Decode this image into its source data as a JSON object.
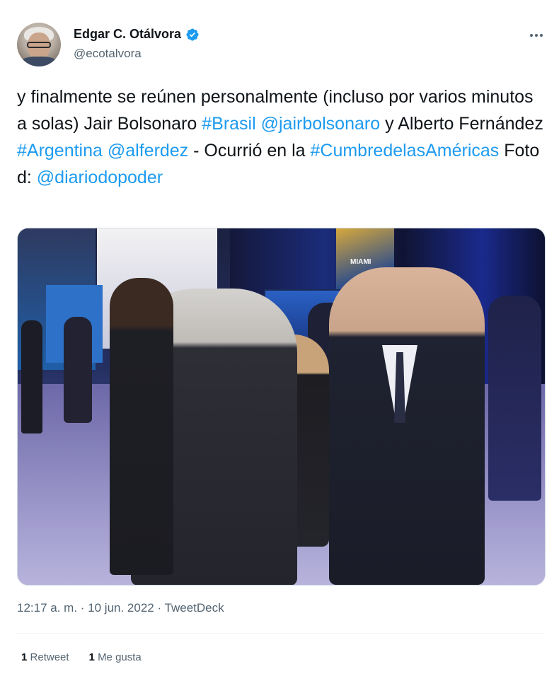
{
  "author": {
    "display_name": "Edgar C. Otálvora",
    "handle": "@ecotalvora",
    "verified": true
  },
  "tweet": {
    "segments": [
      {
        "text": "y finalmente se reúnen personalmente (incluso por varios minutos a solas) Jair Bolsonaro ",
        "link": false
      },
      {
        "text": "#Brasil",
        "link": true
      },
      {
        "text": " ",
        "link": false
      },
      {
        "text": "@jairbolsonaro",
        "link": true
      },
      {
        "text": " y Alberto Fernández ",
        "link": false
      },
      {
        "text": "#Argentina",
        "link": true
      },
      {
        "text": " ",
        "link": false
      },
      {
        "text": "@alferdez",
        "link": true
      },
      {
        "text": " - Ocurrió en la ",
        "link": false
      },
      {
        "text": "#CumbredelasAméricas",
        "link": true
      },
      {
        "text": " Foto d: ",
        "link": false
      },
      {
        "text": "@diariodopoder",
        "link": true
      }
    ],
    "photo_sign_text": "MIAMI"
  },
  "meta": {
    "timestamp": "12:17 a. m. · 10 jun. 2022 · TweetDeck"
  },
  "stats": {
    "retweets_count": "1",
    "retweets_label": "Retweet",
    "likes_count": "1",
    "likes_label": "Me gusta"
  },
  "colors": {
    "link": "#1d9bf0",
    "secondary_text": "#536471",
    "verified_badge": "#1d9bf0"
  },
  "icons": {
    "verified": "verified-badge-icon",
    "more": "more-options-icon"
  }
}
